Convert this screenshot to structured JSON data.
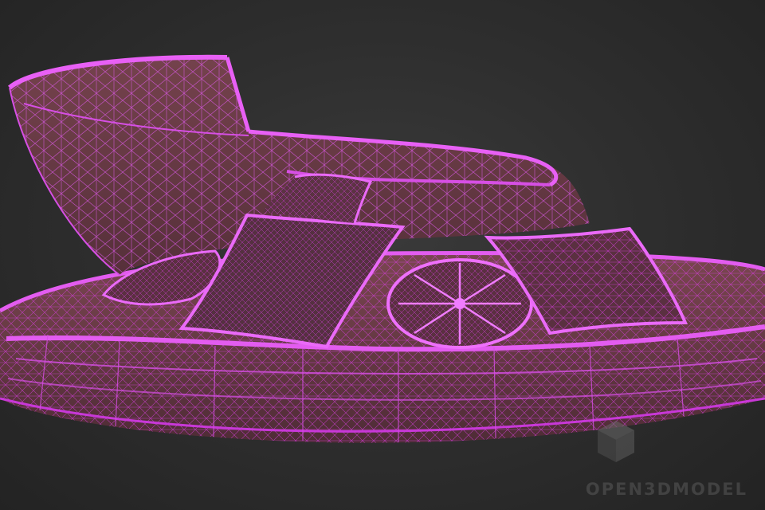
{
  "scene": {
    "background_color": "#2f2f2f",
    "wire_color": "#d63fe0",
    "wire_color_light": "#f07cff",
    "shade_color": "#6b3a44",
    "objects": [
      "round-sofa-base-icon",
      "curved-backrest-icon",
      "square-pillow-icon",
      "round-bolster-pillow-icon"
    ]
  },
  "watermark": {
    "text": "OPEN3DMODEL",
    "icon": "cube-logo-icon",
    "color": "#5a5a5a"
  }
}
